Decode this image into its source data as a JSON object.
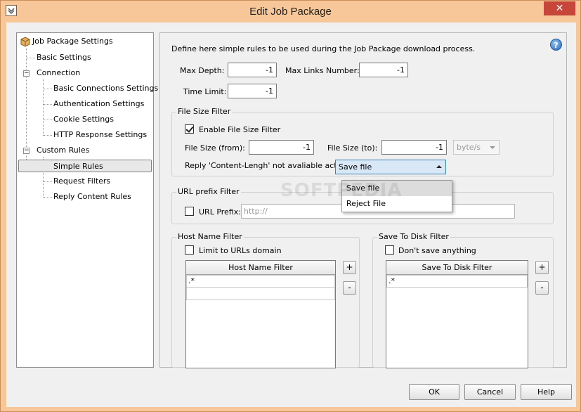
{
  "window": {
    "title": "Edit Job Package",
    "close_glyph": "✕"
  },
  "tree": {
    "items": [
      {
        "label": "Job Package Settings"
      },
      {
        "label": "Basic Settings"
      },
      {
        "label": "Connection"
      },
      {
        "label": "Basic Connections Settings"
      },
      {
        "label": "Authentication Settings"
      },
      {
        "label": "Cookie Settings"
      },
      {
        "label": "HTTP Response Settings"
      },
      {
        "label": "Custom Rules"
      },
      {
        "label": "Simple Rules",
        "selected": true
      },
      {
        "label": "Request Filters"
      },
      {
        "label": "Reply Content Rules"
      }
    ]
  },
  "panel": {
    "description": "Define here simple rules to be used during the Job Package download process.",
    "help_glyph": "?",
    "max_depth": {
      "label": "Max Depth:",
      "value": "-1"
    },
    "max_links": {
      "label": "Max Links Number:",
      "value": "-1"
    },
    "time_limit": {
      "label": "Time Limit:",
      "value": "-1"
    },
    "file_size_filter": {
      "title": "File Size Filter",
      "enable_label": "Enable File Size Filter",
      "enabled": true,
      "from_label": "File Size (from):",
      "from_value": "-1",
      "to_label": "File Size (to):",
      "to_value": "-1",
      "unit": "byte/s",
      "reply_label": "Reply 'Content-Lengh' not avaliable action:",
      "reply_value": "Save file",
      "options": [
        "Save file",
        "Reject File"
      ]
    },
    "url_prefix_filter": {
      "title": "URL prefix Filter",
      "label": "URL Prefix:",
      "placeholder": "http://"
    },
    "host_name_filter": {
      "title": "Host Name Filter",
      "checkbox_label": "Limit to URLs domain",
      "column": "Host Name Filter",
      "rows": [
        ".*",
        ""
      ]
    },
    "save_to_disk_filter": {
      "title": "Save To Disk Filter",
      "checkbox_label": "Don't save anything",
      "column": "Save To Disk Filter",
      "rows": [
        ".*"
      ]
    },
    "add_glyph": "+",
    "remove_glyph": "-"
  },
  "buttons": {
    "ok": "OK",
    "cancel": "Cancel",
    "help": "Help"
  },
  "watermark": "SOFTPEDIA",
  "colors": {
    "frame": "#f7c79a",
    "close": "#c7463b",
    "help_icon": "#2a69b8"
  }
}
